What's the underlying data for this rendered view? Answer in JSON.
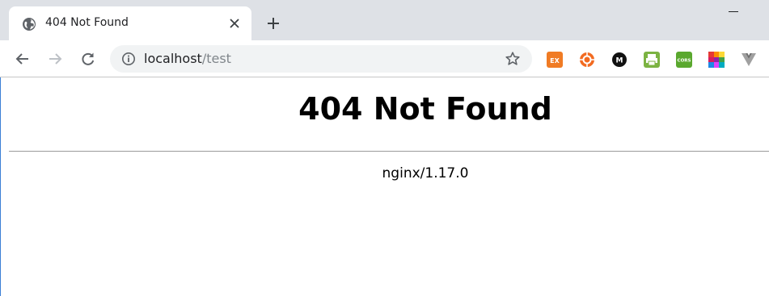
{
  "tab": {
    "title": "404 Not Found",
    "favicon": "globe-icon"
  },
  "toolbar": {
    "url_host": "localhost",
    "url_path": "/test",
    "extensions": [
      {
        "name": "ex-extension-icon",
        "label": "EX",
        "color": "#f07b24"
      },
      {
        "name": "orange-ring-extension-icon",
        "label": "",
        "color": "#f26b21"
      },
      {
        "name": "m-extension-icon",
        "label": "M",
        "color": "#111111"
      },
      {
        "name": "print-extension-icon",
        "label": "",
        "color": "#7cb342"
      },
      {
        "name": "cors-extension-icon",
        "label": "CORS",
        "color": "#5aa82e"
      },
      {
        "name": "color-grid-extension-icon",
        "label": "",
        "color": "#e53935"
      },
      {
        "name": "vuejs-devtools-icon",
        "label": "",
        "color": "#a0a0a0"
      }
    ]
  },
  "page": {
    "heading": "404 Not Found",
    "footer": "nginx/1.17.0"
  },
  "colors": {
    "tabstrip": "#dee1e6",
    "omnibox": "#f1f3f4",
    "accent_edge": "#3b7fd6"
  }
}
